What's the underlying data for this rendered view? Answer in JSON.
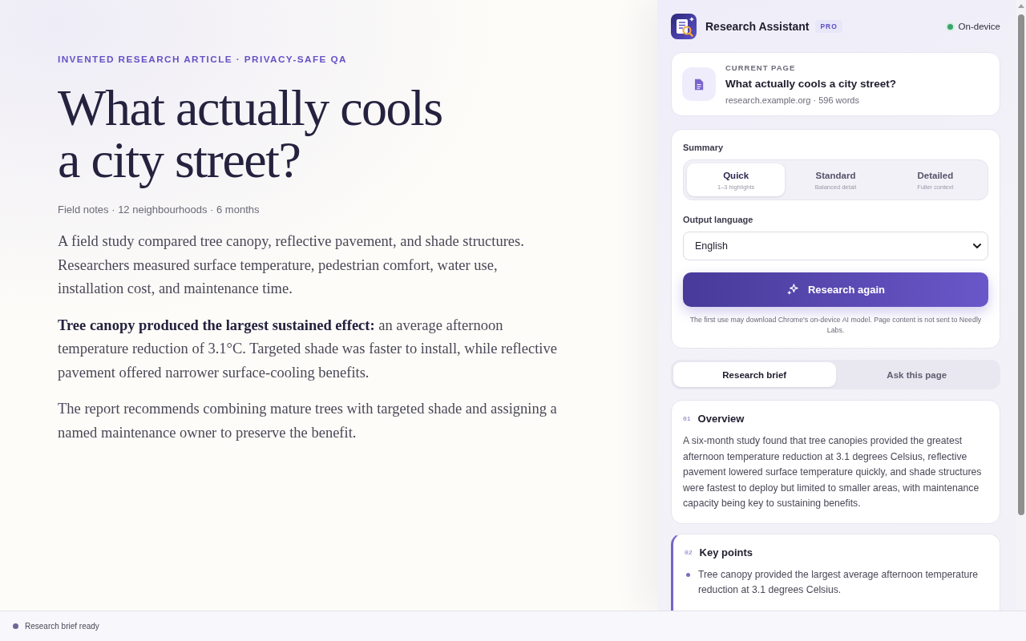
{
  "article": {
    "eyebrow": "INVENTED RESEARCH ARTICLE · PRIVACY-SAFE QA",
    "title": "What actually cools a city street?",
    "meta": "Field notes · 12 neighbourhoods · 6 months",
    "paragraphs": [
      "A field study compared tree canopy, reflective pavement, and shade structures. Researchers measured surface temperature, pedestrian comfort, water use, installation cost, and maintenance time.",
      "**Tree canopy produced the largest sustained effect:** an average afternoon temperature reduction of 3.1°C. Targeted shade was faster to install, while reflective pavement offered narrower surface-cooling benefits.",
      "The report recommends combining mature trees with targeted shade and assigning a named maintenance owner to preserve the benefit."
    ]
  },
  "assistant": {
    "name": "Research Assistant",
    "badge": "PRO",
    "status": "On-device",
    "current_page": {
      "label": "CURRENT PAGE",
      "title": "What actually cools a city street?",
      "meta": "research.example.org · 596 words"
    },
    "summary": {
      "label": "Summary",
      "options": [
        {
          "label": "Quick",
          "hint": "1–3 highlights",
          "selected": true
        },
        {
          "label": "Standard",
          "hint": "Balanced detail",
          "selected": false
        },
        {
          "label": "Detailed",
          "hint": "Fuller context",
          "selected": false
        }
      ]
    },
    "language": {
      "label": "Output language",
      "value": "English"
    },
    "action_button": "Research again",
    "note": "The first use may download Chrome's on-device AI model. Page content is not sent to Needly Labs.",
    "tabs": [
      {
        "label": "Research brief",
        "selected": true
      },
      {
        "label": "Ask this page",
        "selected": false
      }
    ],
    "sections": [
      {
        "number": "01",
        "title": "Overview",
        "kind": "paragraph",
        "highlighted": false,
        "text": "A six-month study found that tree canopies provided the greatest afternoon temperature reduction at 3.1 degrees Celsius, reflective pavement lowered surface temperature quickly, and shade structures were fastest to deploy but limited to smaller areas, with maintenance capacity being key to sustaining benefits."
      },
      {
        "number": "02",
        "title": "Key points",
        "kind": "bullets",
        "highlighted": true,
        "items": [
          "Tree canopy provided the largest average afternoon temperature reduction at 3.1 degrees Celsius."
        ]
      }
    ]
  },
  "status_bar": {
    "text": "Research brief ready"
  }
}
